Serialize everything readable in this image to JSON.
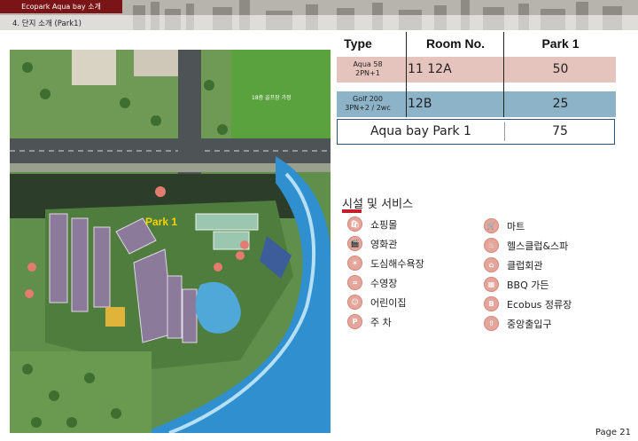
{
  "header": {
    "tab_label": "Ecopark Aqua bay 소개",
    "section_label": "4. 단지 소개 (Park1)"
  },
  "map": {
    "park_label": "Park 1",
    "road_sign": "18층 골프장 가정"
  },
  "table": {
    "headers": {
      "type": "Type",
      "room": "Room No.",
      "park": "Park 1"
    },
    "rows": [
      {
        "type_line1": "Aqua 58",
        "type_line2": "2PN+1",
        "room": "11  12A",
        "park": "50",
        "color": "#e6c4be"
      },
      {
        "type_line1": "Golf 200",
        "type_line2": "3PN+2 / 2wc",
        "room": "12B",
        "park": "25",
        "color": "#8cb3c8"
      }
    ],
    "total": {
      "label": "Aqua bay Park 1",
      "value": "75"
    }
  },
  "facilities": {
    "title": "시설 및 서비스",
    "left": [
      "쇼핑몰",
      "영화관",
      "도심해수욕장",
      "수영장",
      "어린이집",
      "주 차"
    ],
    "right": [
      "마트",
      "헬스클럽&스파",
      "클럽회관",
      "BBQ 가든",
      "Ecobus 정류장",
      "중앙출입구"
    ],
    "icon_color": "#e4a59a"
  },
  "footer": {
    "page": "Page 21"
  }
}
